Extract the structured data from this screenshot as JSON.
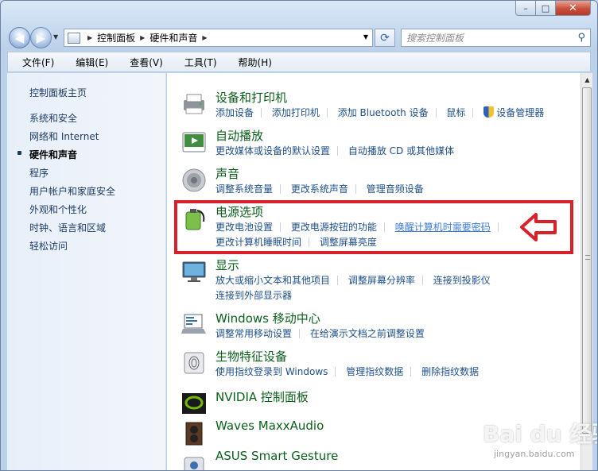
{
  "window": {
    "caption_buttons": {
      "minimize": "–",
      "maximize": "□",
      "close": "✕"
    }
  },
  "nav": {
    "back_icon": "back-arrow-icon",
    "forward_icon": "forward-arrow-icon",
    "address": {
      "segments": [
        "控制面板",
        "硬件和声音"
      ]
    },
    "search_placeholder": "搜索控制面板"
  },
  "menu": {
    "items": [
      "文件(F)",
      "编辑(E)",
      "查看(V)",
      "工具(T)",
      "帮助(H)"
    ]
  },
  "sidebar": {
    "items": [
      {
        "label": "控制面板主页",
        "current": false
      },
      {
        "label": "系统和安全",
        "current": false
      },
      {
        "label": "网络和 Internet",
        "current": false
      },
      {
        "label": "硬件和声音",
        "current": true
      },
      {
        "label": "程序",
        "current": false
      },
      {
        "label": "用户帐户和家庭安全",
        "current": false
      },
      {
        "label": "外观和个性化",
        "current": false
      },
      {
        "label": "时钟、语言和区域",
        "current": false
      },
      {
        "label": "轻松访问",
        "current": false
      }
    ]
  },
  "categories": [
    {
      "title": "设备和打印机",
      "icon": "printer-icon",
      "links": [
        [
          "添加设备",
          "添加打印机",
          "添加 Bluetooth 设备",
          "鼠标",
          "设备管理器"
        ]
      ]
    },
    {
      "title": "自动播放",
      "icon": "autoplay-icon",
      "links": [
        [
          "更改媒体或设备的默认设置",
          "自动播放 CD 或其他媒体"
        ]
      ]
    },
    {
      "title": "声音",
      "icon": "speaker-icon",
      "links": [
        [
          "调整系统音量",
          "更改系统声音",
          "管理音频设备"
        ]
      ]
    },
    {
      "title": "电源选项",
      "icon": "power-options-icon",
      "links": [
        [
          "更改电池设置",
          "更改电源按钮的功能",
          "唤醒计算机时需要密码"
        ],
        [
          "更改计算机睡眠时间",
          "调整屏幕亮度"
        ]
      ]
    },
    {
      "title": "显示",
      "icon": "display-icon",
      "links": [
        [
          "放大或缩小文本和其他项目",
          "调整屏幕分辨率",
          "连接到投影仪"
        ],
        [
          "连接到外部显示器"
        ]
      ]
    },
    {
      "title": "Windows 移动中心",
      "icon": "mobility-center-icon",
      "links": [
        [
          "调整常用移动设置",
          "在给演示文档之前调整设置"
        ]
      ]
    },
    {
      "title": "生物特征设备",
      "icon": "fingerprint-icon",
      "links": [
        [
          "使用指纹登录到 Windows",
          "管理指纹数据",
          "删除指纹数据"
        ]
      ]
    },
    {
      "title": "NVIDIA 控制面板",
      "icon": "nvidia-icon",
      "links": []
    },
    {
      "title": "Waves MaxxAudio",
      "icon": "waves-audio-icon",
      "links": []
    },
    {
      "title": "ASUS Smart Gesture",
      "icon": "asus-gesture-icon",
      "links": []
    }
  ],
  "watermark": {
    "text": "Bai du 经验",
    "sub": "jingyan.baidu.com"
  },
  "colors": {
    "highlight": "#d8202a",
    "category_title": "#0b5f1b",
    "link": "#1e4f8a"
  }
}
